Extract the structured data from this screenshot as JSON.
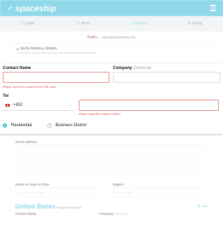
{
  "header": {
    "brand": "spaceship"
  },
  "steps": [
    "1. Quote",
    "2. Items",
    "3. Address",
    "4. Pickup"
  ],
  "carrier": {
    "logo_a": "Fed",
    "logo_b": "Ex",
    "service": "International Priority (IP)"
  },
  "verify": {
    "title": "Verify Address Details",
    "subtitle": "A new pickup request has to be made if the address has to be ammended."
  },
  "form": {
    "contact_name_label": "Contact Name",
    "company_label": "Company",
    "company_optional": "(Optional)",
    "contact_name_error": "Please input the contact person full name",
    "tel_label": "Tel",
    "country_code": "+852",
    "phone_error": "Please input the contact number",
    "residential_label": "Residential",
    "business_label": "Business District"
  },
  "lower": {
    "street_label": "Street address",
    "room_label": "Room or Suite or Floor",
    "room_placeholder": "e.g. Rm 1, 10/F, Blk A",
    "region_label": "Region",
    "region_placeholder": "Please select",
    "recipient_country": "United States",
    "recipient_suffix": "Recipient's Address",
    "contact_name_label": "Contact Name",
    "company_label": "Company",
    "company_optional": "(Optional)"
  },
  "colors": {
    "accent": "#34b9d8",
    "error": "#e05c5c"
  }
}
